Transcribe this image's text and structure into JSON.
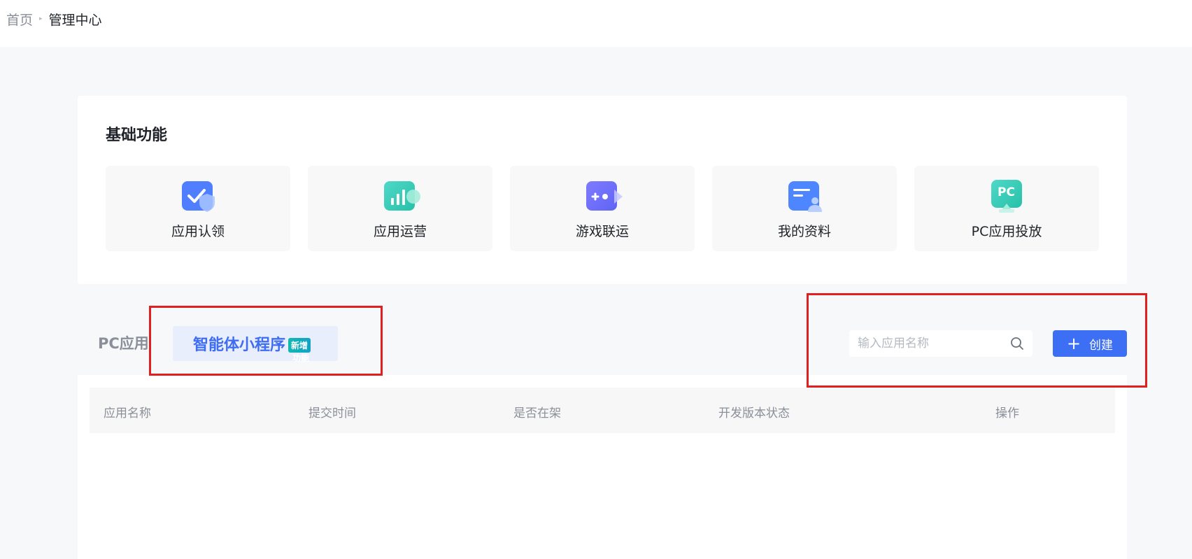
{
  "breadcrumb": {
    "home": "首页",
    "separator": "▸",
    "current": "管理中心"
  },
  "basic": {
    "title": "基础功能",
    "tiles": [
      {
        "label": "应用认领",
        "icon": "claim-shield-icon"
      },
      {
        "label": "应用运营",
        "icon": "bar-chart-icon"
      },
      {
        "label": "游戏联运",
        "icon": "game-controller-icon"
      },
      {
        "label": "我的资料",
        "icon": "profile-card-icon"
      },
      {
        "label": "PC应用投放",
        "icon": "pc-monitor-icon",
        "icon_text": "PC"
      }
    ]
  },
  "tabs": {
    "pc_apps": "PC应用",
    "agent_mini": "智能体小程序",
    "badge_new": "新增",
    "badge_sub": "功能"
  },
  "search": {
    "placeholder": "输入应用名称",
    "value": ""
  },
  "create_button": {
    "label": "创建"
  },
  "table": {
    "columns": [
      "应用名称",
      "提交时间",
      "是否在架",
      "开发版本状态",
      "操作"
    ]
  },
  "colors": {
    "primary": "#3d6ff5",
    "annotation": "#e02020",
    "badge": "#12b8b0"
  }
}
